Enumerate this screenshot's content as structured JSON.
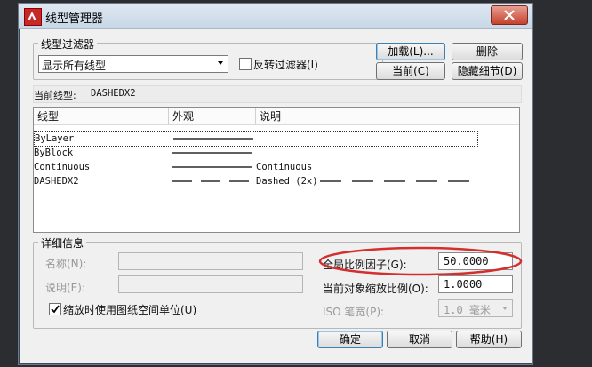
{
  "window": {
    "title": "线型管理器",
    "close_label": "X"
  },
  "filter_group": {
    "legend": "线型过滤器",
    "selected": "显示所有线型",
    "invert_label": "反转过滤器(I)",
    "invert_checked": false
  },
  "buttons": {
    "load": "加载(L)...",
    "delete": "删除",
    "current": "当前(C)",
    "hide_details": "隐藏细节(D)",
    "ok": "确定",
    "cancel": "取消",
    "help": "帮助(H)"
  },
  "current_linetype": {
    "label": "当前线型:",
    "value": "DASHEDX2"
  },
  "table": {
    "columns": [
      "线型",
      "外观",
      "说明"
    ],
    "rows": [
      {
        "name": "ByLayer",
        "appearance": "solid",
        "description": ""
      },
      {
        "name": "ByBlock",
        "appearance": "solid",
        "description": ""
      },
      {
        "name": "Continuous",
        "appearance": "solid",
        "description": "Continuous"
      },
      {
        "name": "DASHEDX2",
        "appearance": "dashed",
        "description": "Dashed (2x)"
      }
    ]
  },
  "details": {
    "legend": "详细信息",
    "name_label": "名称(N):",
    "desc_label": "说明(E):",
    "paper_units_label": "缩放时使用图纸空间单位(U)",
    "paper_units_checked": true,
    "global_scale_label": "全局比例因子(G):",
    "global_scale_value": "50.0000",
    "object_scale_label": "当前对象缩放比例(O):",
    "object_scale_value": "1.0000",
    "iso_pen_label": "ISO 笔宽(P):",
    "iso_pen_value": "1.0 毫米"
  },
  "colors": {
    "highlight_ellipse": "#d32f2f"
  }
}
